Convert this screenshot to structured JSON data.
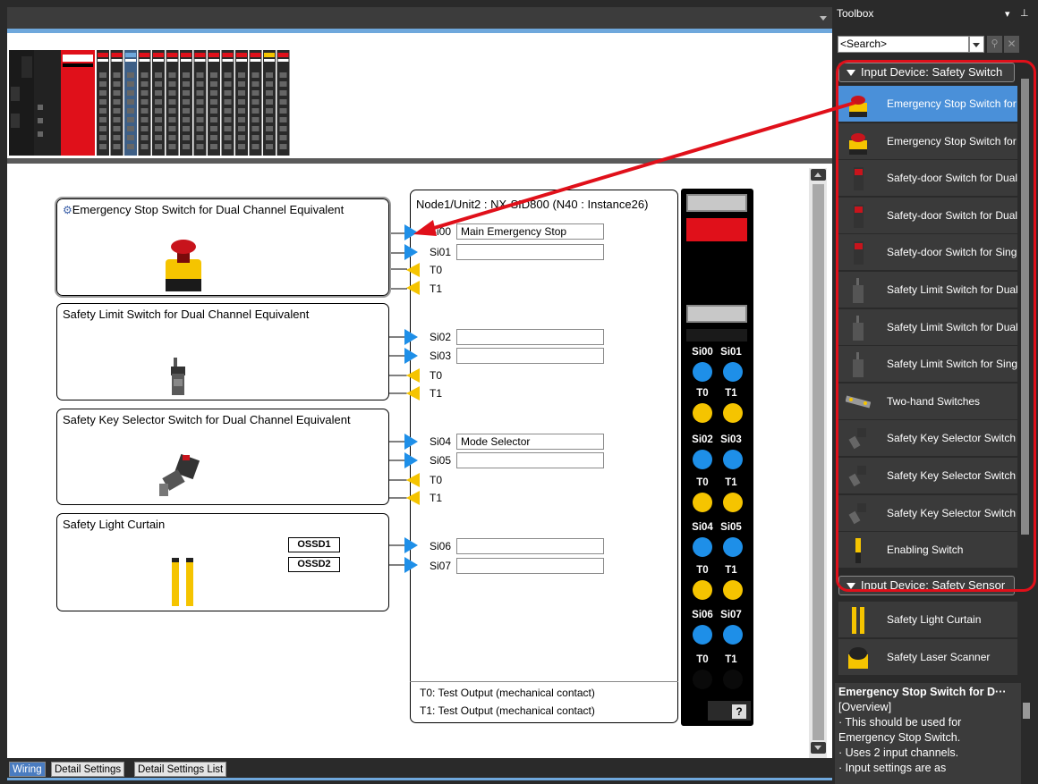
{
  "toolbox": {
    "title": "Toolbox",
    "search_placeholder": "<Search>",
    "category1": "Input Device: Safety Switch",
    "category2": "Input Device: Safety Sensor",
    "items": [
      "Emergency Stop Switch for Dual Channel Equivalent",
      "Emergency Stop Switch for Single Channel",
      "Safety-door Switch for Dual Channel Equivalent",
      "Safety-door Switch for Dual Channel Complementary",
      "Safety-door Switch for Single Channel",
      "Safety Limit Switch for Dual Channel Equivalent",
      "Safety Limit Switch for Dual Channel Complementary",
      "Safety Limit Switch for Single Channel",
      "Two-hand Switches",
      "Safety Key Selector Switch for Dual Channel Equivalent",
      "Safety Key Selector Switch for Dual Channel Complementary",
      "Safety Key Selector Switch for Single Channel",
      "Enabling Switch"
    ],
    "sensor_items": [
      "Safety Light Curtain",
      "Safety Laser Scanner"
    ],
    "desc_title": "Emergency Stop Switch for D···",
    "desc_overview": "[Overview]",
    "desc_line1": "· This should be used for",
    "desc_line2": "Emergency Stop Switch.",
    "desc_line3": "· Uses 2 input channels.",
    "desc_line4": "· Input settings are as"
  },
  "devices": {
    "estop": "Emergency Stop Switch for Dual Channel Equivalent",
    "limit": "Safety Limit Switch for Dual Channel Equivalent",
    "key": "Safety Key Selector Switch for Dual Channel Equivalent",
    "curtain": "Safety Light Curtain",
    "ossd1": "OSSD1",
    "ossd2": "OSSD2"
  },
  "unit": {
    "title": "Node1/Unit2 : NX-SID800 (N40 : Instance26)",
    "pins": {
      "si00": "Si00",
      "si01": "Si01",
      "si02": "Si02",
      "si03": "Si03",
      "si04": "Si04",
      "si05": "Si05",
      "si06": "Si06",
      "si07": "Si07",
      "t0": "T0",
      "t1": "T1"
    },
    "values": {
      "si00": "Main Emergency Stop",
      "si01": "",
      "si02": "",
      "si03": "",
      "si04": "Mode Selector",
      "si05": "",
      "si06": "",
      "si07": ""
    },
    "foot_t0": "T0: Test Output (mechanical contact)",
    "foot_t1": "T1: Test Output (mechanical contact)"
  },
  "module": {
    "labels": [
      "Si00",
      "Si01",
      "T0",
      "T1",
      "Si02",
      "Si03",
      "T0",
      "T1",
      "Si04",
      "Si05",
      "T0",
      "T1",
      "Si06",
      "Si07",
      "T0",
      "T1"
    ],
    "help": "?"
  },
  "tabs": {
    "wiring": "Wiring",
    "detail": "Detail Settings",
    "list": "Detail Settings List"
  }
}
